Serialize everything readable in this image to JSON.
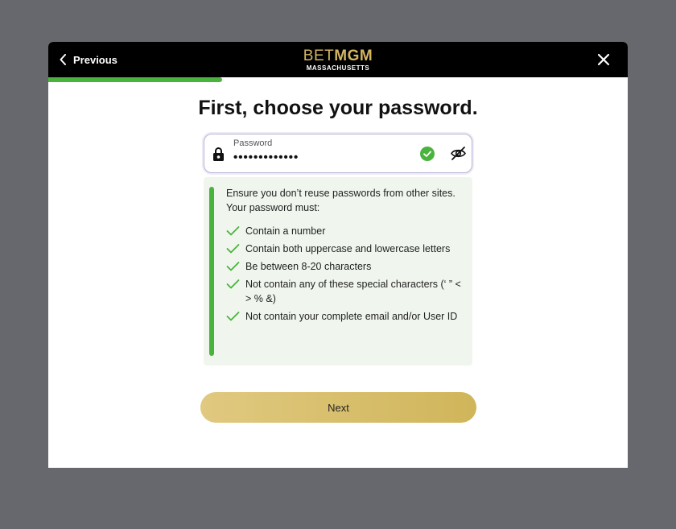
{
  "header": {
    "previous_label": "Previous",
    "logo_bet": "BET",
    "logo_mgm": "MGM",
    "logo_sub": "MASSACHUSETTS"
  },
  "progress": {
    "fraction": 0.3
  },
  "title": {
    "prefix": "First, choose your ",
    "emphasis": "password",
    "suffix": "."
  },
  "password_field": {
    "label": "Password",
    "value": "•••••••••••••",
    "status": "valid"
  },
  "rules": {
    "intro": "Ensure you don’t reuse passwords from other sites. Your password must:",
    "items": [
      "Contain a number",
      "Contain both uppercase and lowercase letters",
      "Be between 8-20 characters",
      "Not contain any of these special characters (‘ ” < > % &)",
      "Not contain your complete email and/or User ID"
    ]
  },
  "next_button": {
    "label": "Next"
  },
  "colors": {
    "brand_gold": "#d4b563",
    "success_green": "#4ab33d",
    "backdrop": "#67686d"
  }
}
